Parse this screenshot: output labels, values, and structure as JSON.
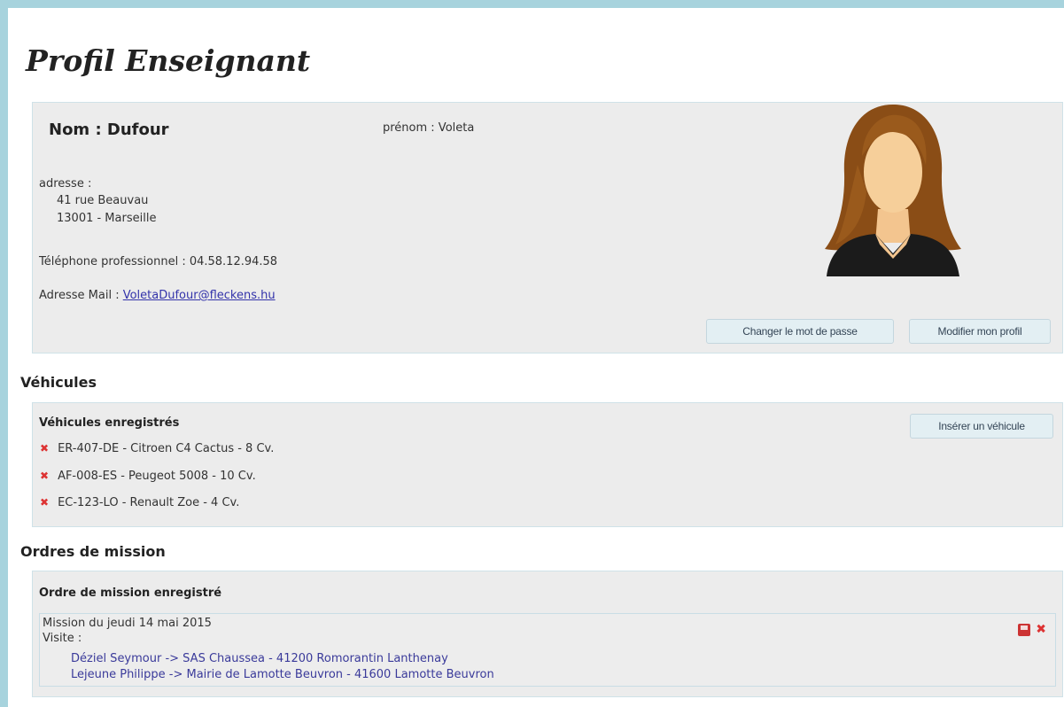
{
  "page": {
    "title": "Profil Enseignant"
  },
  "profile": {
    "name": "Nom : Dufour",
    "firstname": "prénom : Voleta",
    "address_label": "adresse :",
    "address_line1": "41 rue Beauvau",
    "address_line2": "13001 - Marseille",
    "phone": "Téléphone professionnel : 04.58.12.94.58",
    "mail_label": "Adresse Mail :",
    "mail_value": "VoletaDufour@fleckens.hu",
    "btn_change_password": "Changer le mot de passe",
    "btn_edit_profile": "Modifier mon profil"
  },
  "vehicles": {
    "section_title": "Véhicules",
    "subtitle": "Véhicules enregistrés",
    "insert_button": "Insérer un véhicule",
    "items": [
      "ER-407-DE - Citroen C4 Cactus - 8 Cv.",
      "AF-008-ES - Peugeot 5008 - 10 Cv.",
      "EC-123-LO - Renault Zoe - 4 Cv."
    ]
  },
  "missions": {
    "section_title": "Ordres de mission",
    "subtitle": "Ordre de mission enregistré",
    "mission_title": "Mission du jeudi 14 mai 2015",
    "visit_label": "Visite :",
    "visits": [
      "Déziel Seymour -> SAS Chaussea - 41200 Romorantin Lanthenay",
      "Lejeune Philippe -> Mairie de Lamotte Beuvron - 41600 Lamotte Beuvron"
    ]
  },
  "icons": {
    "delete": "delete-icon",
    "print": "print-icon",
    "avatar": "user-avatar"
  },
  "colors": {
    "frame": "#a7d3dd",
    "panel": "#ececec",
    "link": "#3333aa",
    "delete": "#dd3333"
  }
}
